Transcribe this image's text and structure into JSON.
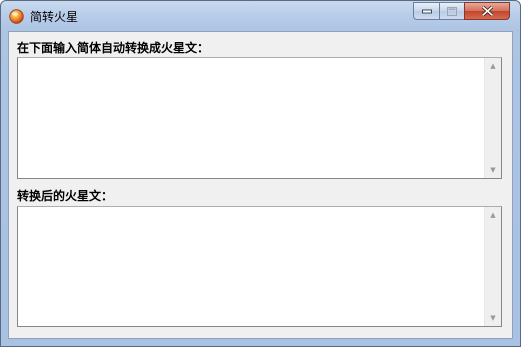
{
  "window": {
    "title": "简转火星"
  },
  "caption": {
    "minimize_glyph": "▁",
    "maximize_glyph": "□",
    "close_glyph": "✕"
  },
  "input_section": {
    "label": "在下面输入简体自动转换成火星文：",
    "value": ""
  },
  "output_section": {
    "label": "转换后的火星文：",
    "value": ""
  },
  "scrollbar": {
    "up_glyph": "▲",
    "down_glyph": "▼"
  },
  "colors": {
    "frame": "#adc4e3",
    "client_bg": "#f0f0f0",
    "close_red": "#c4452d"
  }
}
